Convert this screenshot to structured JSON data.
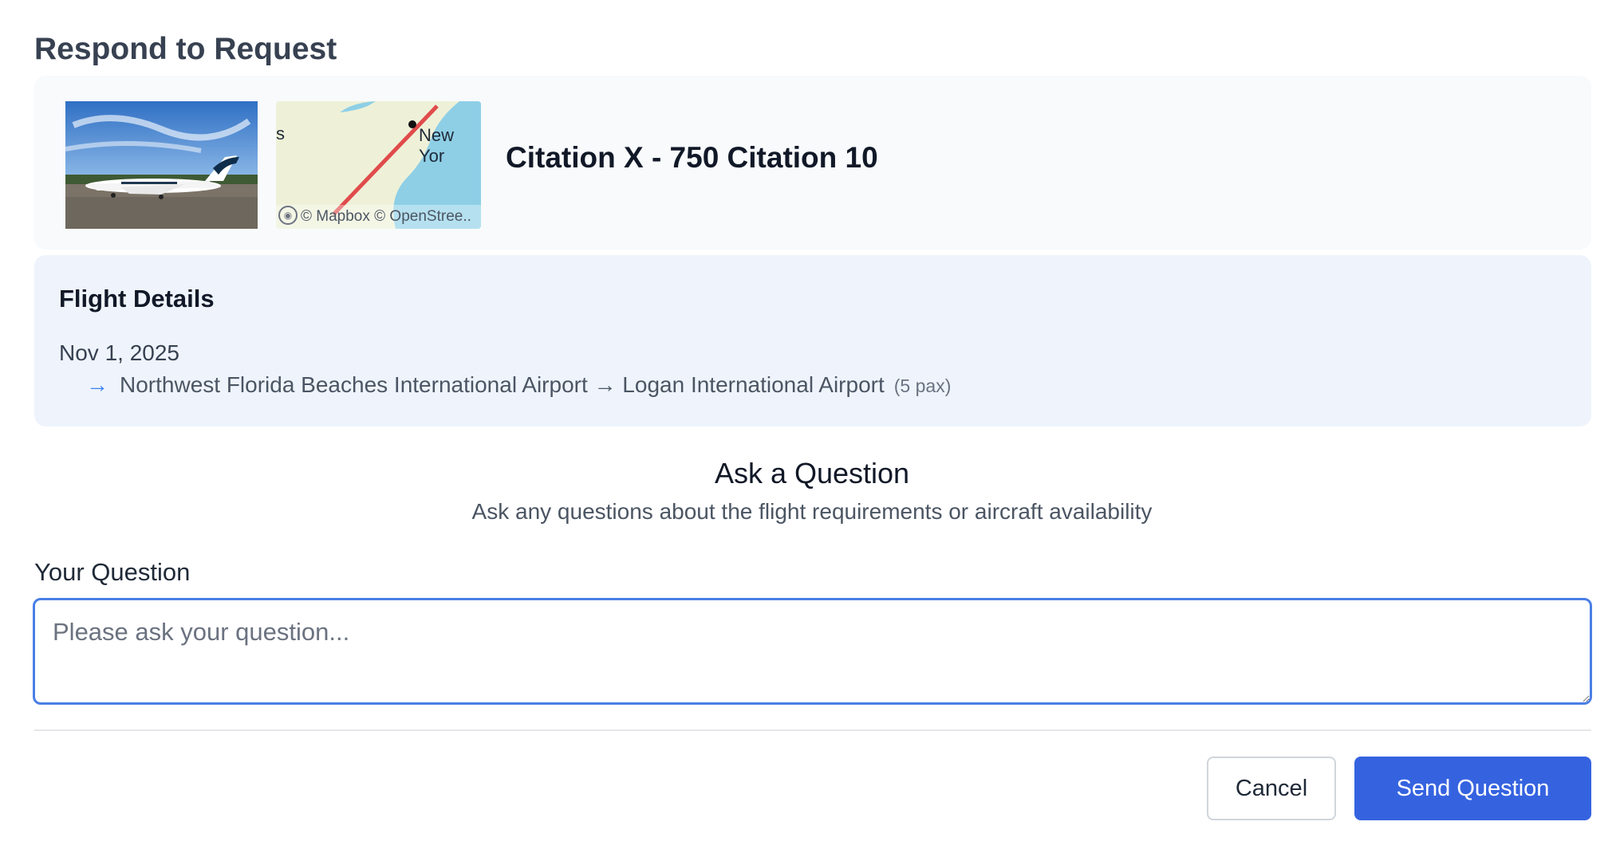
{
  "header": {
    "title": "Respond to Request"
  },
  "aircraft": {
    "name": "Citation X - 750 Citation 10",
    "map": {
      "edge_label": "s",
      "city_label": "New Yor",
      "attribution": "© Mapbox © OpenStree..",
      "attribution_logo_icon": "mapbox-logo-icon"
    }
  },
  "flight": {
    "heading": "Flight Details",
    "date": "Nov 1, 2025",
    "route_arrow": "→",
    "route": "Northwest Florida Beaches International Airport → Logan International Airport",
    "pax": "(5 pax)"
  },
  "question": {
    "title": "Ask a Question",
    "subtitle": "Ask any questions about the flight requirements or aircraft availability",
    "label": "Your Question",
    "placeholder": "Please ask your question...",
    "value": ""
  },
  "actions": {
    "cancel_label": "Cancel",
    "send_label": "Send Question"
  },
  "colors": {
    "primary": "#3563e0",
    "focus_border": "#4a7ee6",
    "card_bg": "#f8fafc",
    "flight_card_bg": "#eff4fc",
    "route_line": "#e04b4b"
  }
}
